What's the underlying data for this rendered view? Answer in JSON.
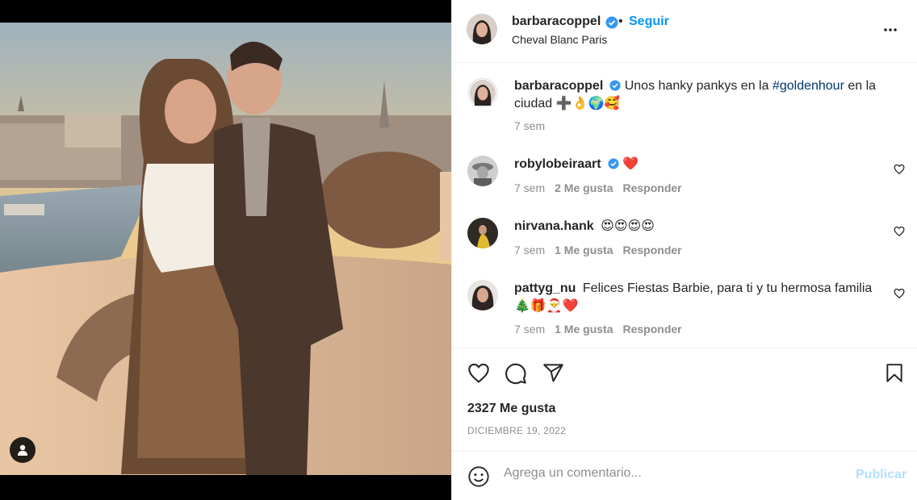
{
  "header": {
    "username": "barbaracoppel",
    "dot": "•",
    "follow_label": "Seguir",
    "location": "Cheval Blanc Paris"
  },
  "caption": {
    "username": "barbaracoppel",
    "text": "Unos hanky pankys en la ",
    "hashtag": "#goldenhour",
    "text_after": " en la ciudad",
    "emojis": "➕👌🌍🥰",
    "time": "7 sem"
  },
  "comments": [
    {
      "username": "robylobeiraart",
      "verified": true,
      "text": "❤️",
      "time": "7 sem",
      "likes": "2 Me gusta",
      "reply": "Responder"
    },
    {
      "username": "nirvana.hank",
      "verified": false,
      "text": "😍😍😍😍",
      "time": "7 sem",
      "likes": "1 Me gusta",
      "reply": "Responder"
    },
    {
      "username": "pattyg_nu",
      "verified": false,
      "text": "Felices Fiestas Barbie, para ti y tu hermosa familia 🎄🎁🎅❤️",
      "time": "7 sem",
      "likes": "1 Me gusta",
      "reply": "Responder"
    }
  ],
  "post": {
    "likes_count": "2327 Me gusta",
    "date": "DICIEMBRE 19, 2022"
  },
  "composer": {
    "placeholder": "Agrega un comentario...",
    "publish_label": "Publicar"
  },
  "icons": {
    "like": "heart-icon",
    "comment": "comment-icon",
    "share": "share-icon",
    "save": "bookmark-icon",
    "more": "more-options-icon",
    "emoji": "emoji-icon",
    "user_tag": "user-tag-icon",
    "verified": "verified-badge-icon"
  },
  "colors": {
    "accent": "#0095f6",
    "verified": "#3897f0",
    "muted": "#8e8e8e",
    "publish_disabled": "#b2dffc"
  }
}
